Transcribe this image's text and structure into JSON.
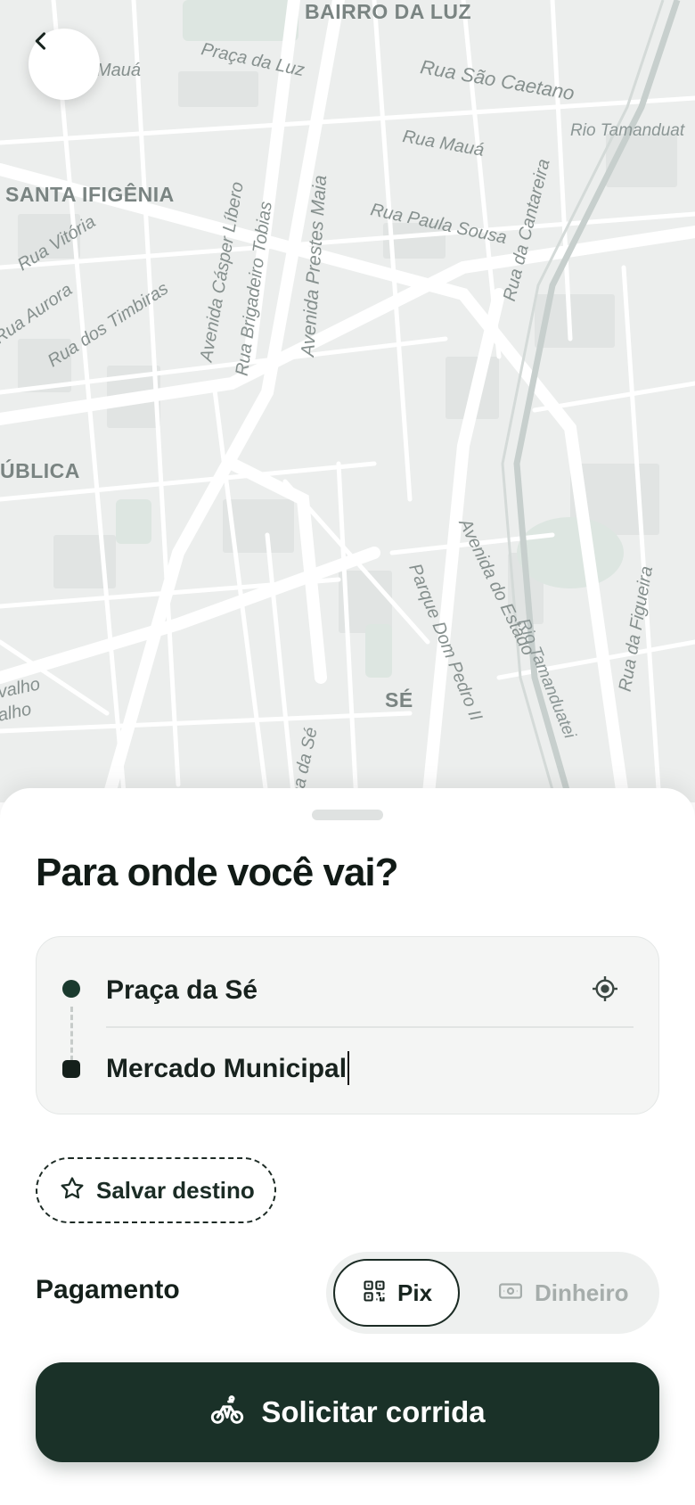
{
  "map": {
    "districts": [
      "BAIRRO DA LUZ",
      "SANTA IFIGÊNIA",
      "ÚBLICA",
      "SÉ"
    ],
    "streets": [
      "Mauá",
      "Praça da Luz",
      "Rua São Caetano",
      "Rio Tamanduat",
      "Rua Mauá",
      "Rua Vitória",
      "Rua Aurora",
      "Rua dos Timbiras",
      "Avenida Cásper Líbero",
      "Rua Brigadeiro Tobias",
      "Avenida Prestes Maia",
      "Rua Paula Sousa",
      "Rua da Cantareira",
      "Avenida do Estado",
      "Parque Dom Pedro II",
      "Rio Tamanduatei",
      "Rua da Figueira",
      "valho",
      "alho",
      "ca da Sé"
    ]
  },
  "header": {
    "back_icon": "chevron-left-icon"
  },
  "sheet": {
    "title": "Para onde você vai?",
    "route": {
      "origin": "Praça da Sé",
      "destination": "Mercado Municipal",
      "locate_icon": "crosshair-icon"
    },
    "save_destination": {
      "label": "Salvar destino",
      "icon": "star-icon"
    },
    "payment": {
      "label": "Pagamento",
      "options": [
        {
          "label": "Pix",
          "icon": "qr-code-icon",
          "selected": true
        },
        {
          "label": "Dinheiro",
          "icon": "banknote-icon",
          "selected": false
        }
      ]
    },
    "request": {
      "label": "Solicitar corrida",
      "icon": "bike-icon"
    }
  },
  "colors": {
    "primary": "#1a3128",
    "map_bg": "#eceeed",
    "street": "#ffffff",
    "text": "#14201b",
    "muted": "#a6adab"
  }
}
